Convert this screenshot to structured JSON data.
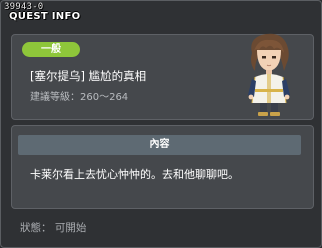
{
  "window": {
    "quest_id": "39943-0",
    "title": "QUEST INFO"
  },
  "quest": {
    "category": "一般",
    "name": "[塞尔提乌] 尴尬的真相",
    "level": "建議等級：260～264"
  },
  "content": {
    "header": "內容",
    "description": "卡莱尔看上去忧心忡忡的。去和他聊聊吧。"
  },
  "status": {
    "text": "狀態： 可開始"
  },
  "colors": {
    "badge": "#8ec63a",
    "panel": "#45484c",
    "header_bar": "#5e6a73",
    "window_bg": "#2f3134"
  }
}
